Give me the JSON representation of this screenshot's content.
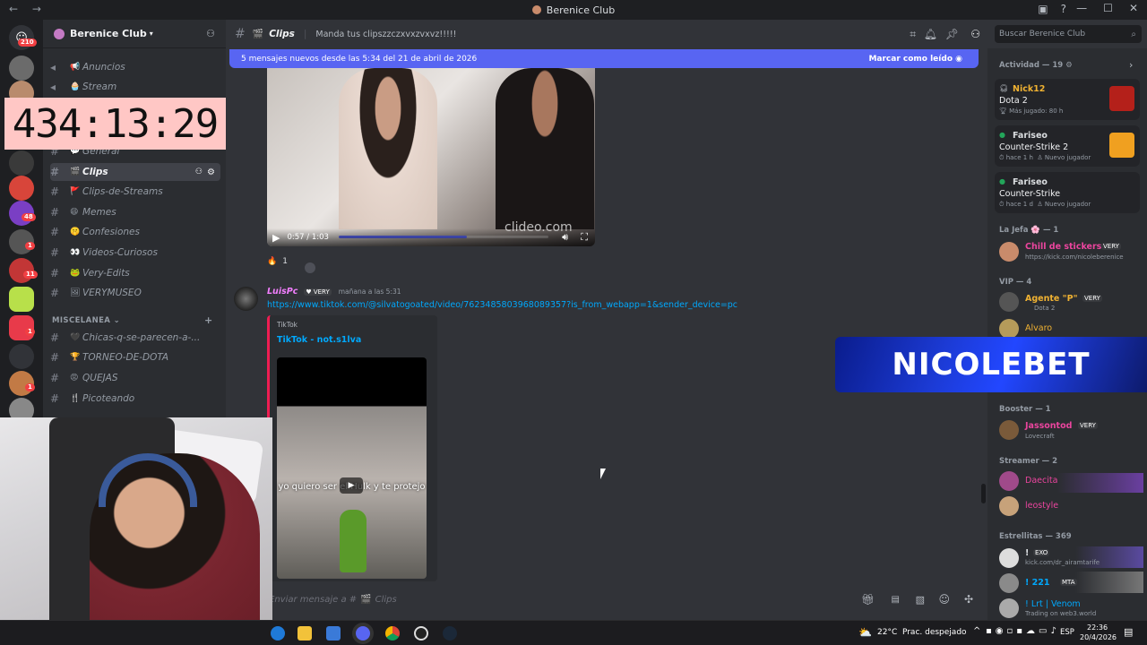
{
  "window": {
    "title": "Berenice Club"
  },
  "timer": "434:13:29",
  "server": {
    "name": "Berenice Club"
  },
  "rail_badges": [
    "210",
    "48",
    "1",
    "11",
    "1",
    "1"
  ],
  "channels": [
    {
      "label": "Anuncios",
      "emoji": "📢"
    },
    {
      "label": "Stream",
      "emoji": "🧁"
    },
    {
      "label": "General",
      "emoji": "💬"
    },
    {
      "label": "Clips",
      "emoji": "🎬"
    },
    {
      "label": "Clips-de-Streams",
      "emoji": "🚩"
    },
    {
      "label": "Memes",
      "emoji": "😄"
    },
    {
      "label": "Confesiones",
      "emoji": "🤫"
    },
    {
      "label": "Videos-Curiosos",
      "emoji": "👀"
    },
    {
      "label": "Very-Edits",
      "emoji": "🐸"
    },
    {
      "label": "VERYMUSEO",
      "emoji": "🖼"
    }
  ],
  "category2": "MISCELANEA",
  "channels2": [
    {
      "label": "Chicas-q-se-parecen-a-...",
      "emoji": "🖤"
    },
    {
      "label": "TORNEO-DE-DOTA",
      "emoji": "🏆"
    },
    {
      "label": "QUEJAS",
      "emoji": "😡"
    },
    {
      "label": "Picoteando",
      "emoji": "🍴"
    }
  ],
  "header": {
    "channel": "Clips",
    "topic": "Manda tus clipszzczxvxzvxvz!!!!!"
  },
  "banner": {
    "text": "5 mensajes nuevos desde las 5:34 del 21 de abril de 2026",
    "action": "Marcar como leído"
  },
  "video": {
    "time": "0:57 / 1:03",
    "progress": 0.61,
    "watermark": "clideo.com"
  },
  "reaction": {
    "count": "1"
  },
  "message": {
    "author": "LuisPc",
    "role_tag": "VERY",
    "timestamp": "mañana a las 5:31",
    "link": "https://www.tiktok.com/@silvatogoated/video/7623485803968089357?is_from_webapp=1&sender_device=pc",
    "embed_provider": "TikTok",
    "embed_title": "TikTok - not.s1lva",
    "embed_caption": "yo quiero ser el Hulk y te protejo"
  },
  "input": {
    "placeholder": "Enviar mensaje a #",
    "channel": "Clips"
  },
  "search": {
    "placeholder": "Buscar Berenice Club"
  },
  "members": {
    "activity_header": "Actividad — 19",
    "activities": [
      {
        "name": "Nick12",
        "game": "Dota 2",
        "detail": "Más jugado: 80 h",
        "color": "#f0b232"
      },
      {
        "name": "Fariseo",
        "game": "Counter-Strike 2",
        "detail": "hace 1 h",
        "extra": "Nuevo jugador",
        "color": "#f23f43"
      },
      {
        "name": "Fariseo",
        "game": "Counter-Strike",
        "detail": "hace 1 d",
        "extra": "Nuevo jugador",
        "color": "#f23f43"
      }
    ],
    "groups": [
      {
        "header": "La Jefa 🌸 — 1",
        "members": [
          {
            "name": "Chill de stickers",
            "tag": "VERY",
            "sub": "https://kick.com/nicoleberenice",
            "color": "#f47fff"
          }
        ]
      },
      {
        "header": "VIP — 4",
        "members": [
          {
            "name": "Agente \"P\"",
            "tag": "VERY",
            "sub": "Dota 2",
            "color": "#f0b232"
          },
          {
            "name": "Alvaro",
            "tag": "",
            "sub": "",
            "color": "#f0b232"
          }
        ]
      },
      {
        "header": "Booster — 1",
        "members": [
          {
            "name": "Jassontod",
            "tag": "VERY",
            "sub": "Lovecraft",
            "color": "#f47fff"
          }
        ]
      },
      {
        "header": "Streamer — 2",
        "members": [
          {
            "name": "Daecita",
            "tag": "",
            "sub": "",
            "color": "#eb459e"
          },
          {
            "name": "leostyle",
            "tag": "",
            "sub": "",
            "color": "#eb459e"
          }
        ]
      },
      {
        "header": "Estrellitas — 369",
        "members": [
          {
            "name": "!",
            "tag": "EXO",
            "sub": "kick.com/dr_airamtarife",
            "color": "#dbdee1"
          },
          {
            "name": "! 221",
            "tag": "MTA",
            "sub": "",
            "color": "#dbdee1"
          },
          {
            "name": "! Lrt | Venom",
            "tag": "",
            "sub": "Trading on web3.world",
            "color": "#dbdee1"
          }
        ]
      }
    ]
  },
  "overlay_brand": "NICOLEBET",
  "taskbar": {
    "weather": "22°C  Prac. despejado",
    "lang": "ESP",
    "time": "22:36",
    "date": "20/4/2026"
  }
}
